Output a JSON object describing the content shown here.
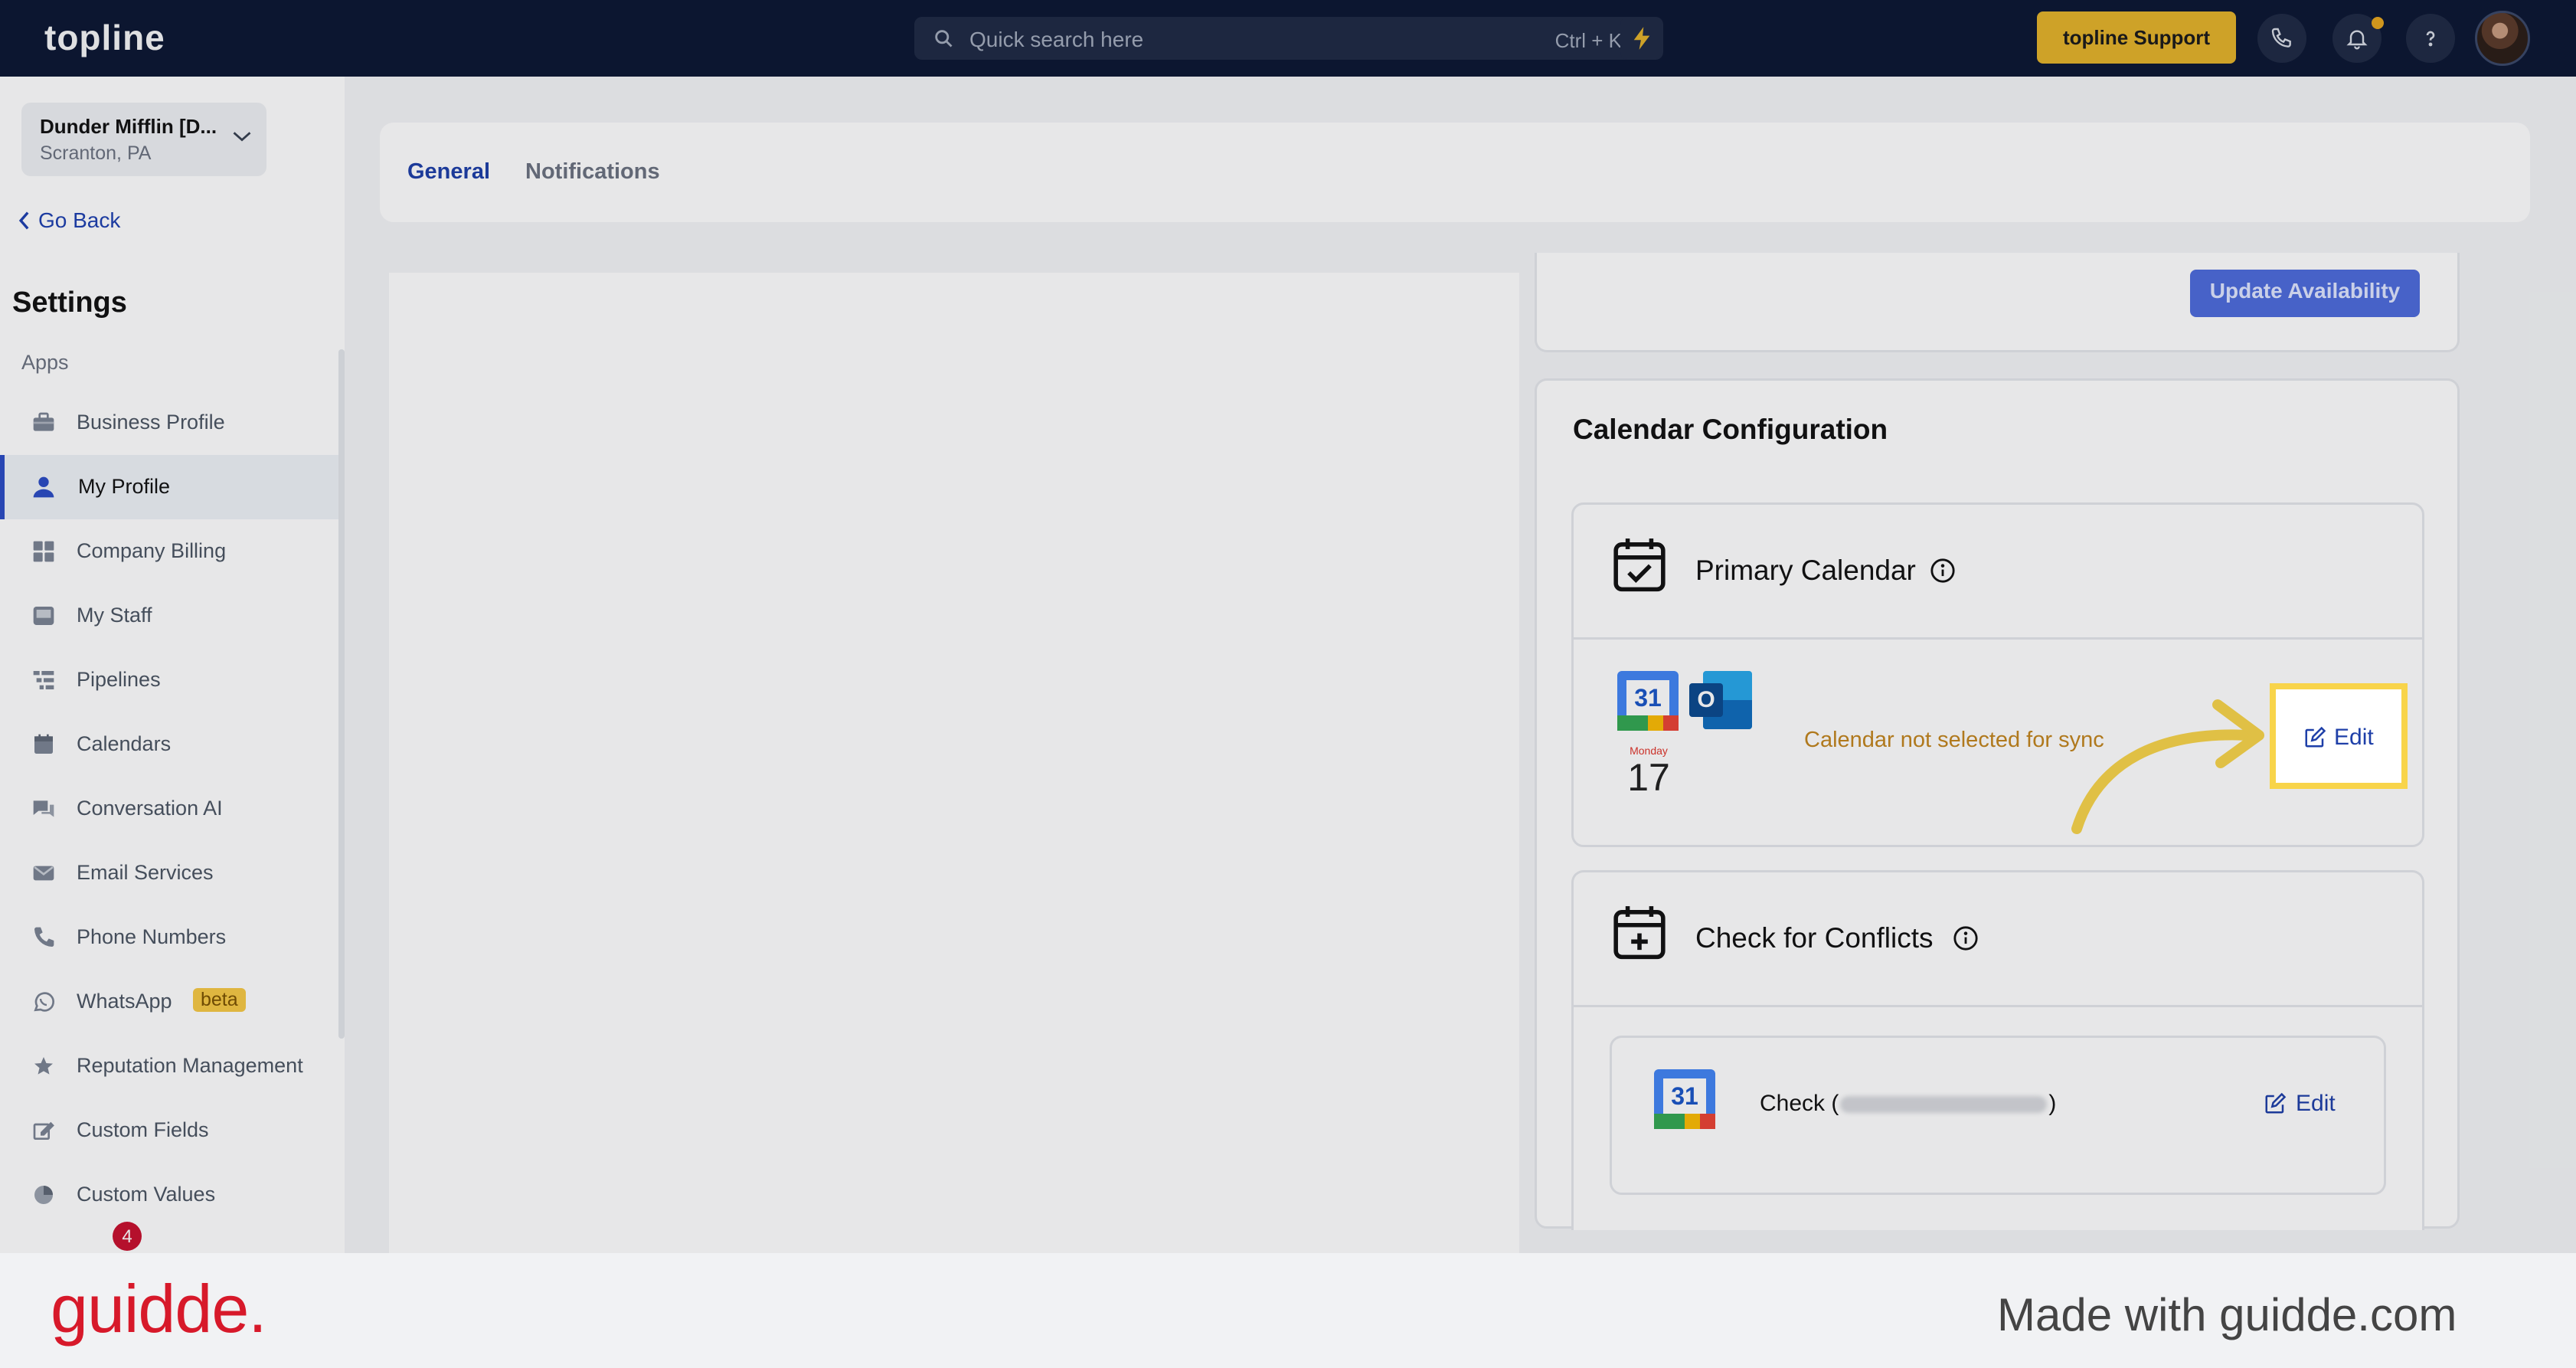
{
  "app": {
    "logo": "topline"
  },
  "topbar": {
    "search_placeholder": "Quick search here",
    "search_shortcut": "Ctrl + K",
    "support_label": "topline Support"
  },
  "sidebar": {
    "location_name": "Dunder Mifflin [D...",
    "location_city": "Scranton, PA",
    "go_back": "Go Back",
    "title": "Settings",
    "section": "Apps",
    "items": [
      {
        "label": "Business Profile",
        "icon": "briefcase-icon"
      },
      {
        "label": "My Profile",
        "icon": "user-icon"
      },
      {
        "label": "Company Billing",
        "icon": "grid-icon"
      },
      {
        "label": "My Staff",
        "icon": "inbox-icon"
      },
      {
        "label": "Pipelines",
        "icon": "filter-icon"
      },
      {
        "label": "Calendars",
        "icon": "calendar-icon"
      },
      {
        "label": "Conversation AI",
        "icon": "chat-icon"
      },
      {
        "label": "Email Services",
        "icon": "mail-icon"
      },
      {
        "label": "Phone Numbers",
        "icon": "phone-icon"
      },
      {
        "label": "WhatsApp",
        "icon": "whatsapp-icon",
        "badge": "beta"
      },
      {
        "label": "Reputation Management",
        "icon": "star-icon"
      },
      {
        "label": "Custom Fields",
        "icon": "pencil-square-icon"
      },
      {
        "label": "Custom Values",
        "icon": "pie-icon"
      }
    ],
    "widget_count": "4"
  },
  "tabs": {
    "general": "General",
    "notifications": "Notifications"
  },
  "main": {
    "update_button": "Update Availability",
    "calendar_config_title": "Calendar Configuration",
    "primary_calendar_title": "Primary Calendar",
    "google_cal_day": "31",
    "apple_cal_weekday": "Monday",
    "apple_cal_day": "17",
    "outlook_letter": "O",
    "not_selected": "Calendar not selected for sync",
    "edit_label": "Edit",
    "conflicts_title": "Check for Conflicts",
    "check_prefix": "Check (",
    "check_suffix": ")",
    "edit_label_2": "Edit"
  },
  "footer": {
    "brand": "guidde.",
    "made_with": "Made with guidde.com"
  },
  "colors": {
    "accent": "#1e3fa8",
    "highlight": "#f8d44a",
    "topbar": "#0c1733",
    "support": "#e4b32a",
    "warning": "#c2851e"
  }
}
